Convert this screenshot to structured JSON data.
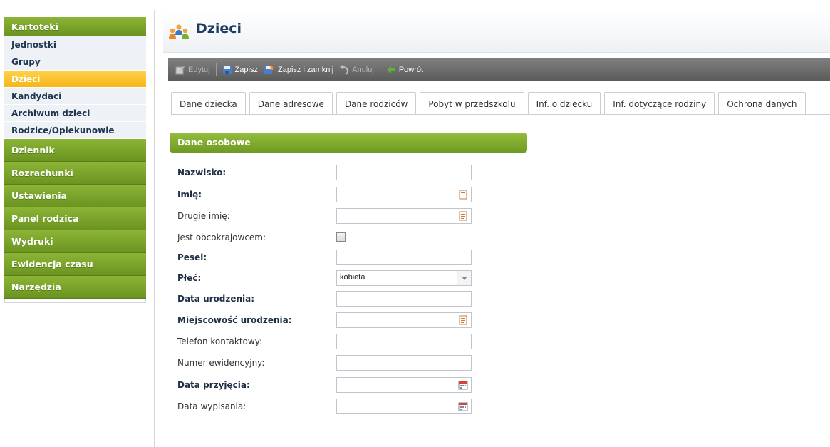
{
  "sidebar": {
    "kartoteki": "Kartoteki",
    "sub_items": [
      "Jednostki",
      "Grupy",
      "Dzieci",
      "Kandydaci",
      "Archiwum dzieci",
      "Rodzice/Opiekunowie"
    ],
    "groups": [
      "Dziennik",
      "Rozrachunki",
      "Ustawienia",
      "Panel rodzica",
      "Wydruki",
      "Ewidencja czasu",
      "Narzędzia"
    ]
  },
  "page": {
    "title": "Dzieci",
    "icon": "children-icon"
  },
  "toolbar": {
    "edit": "Edytuj",
    "save": "Zapisz",
    "save_close": "Zapisz i zamknij",
    "cancel": "Anuluj",
    "back": "Powrót"
  },
  "tabs": [
    "Dane dziecka",
    "Dane adresowe",
    "Dane rodziców",
    "Pobyt w przedszkolu",
    "Inf. o dziecku",
    "Inf. dotyczące rodziny",
    "Ochrona danych"
  ],
  "section": {
    "title": "Dane osobowe"
  },
  "form": {
    "nazwisko": {
      "label": "Nazwisko:",
      "value": ""
    },
    "imie": {
      "label": "Imię:",
      "value": ""
    },
    "drugie_imie": {
      "label": "Drugie imię:",
      "value": ""
    },
    "obcokrajowiec": {
      "label": "Jest obcokrajowcem:",
      "checked": false
    },
    "pesel": {
      "label": "Pesel:",
      "value": ""
    },
    "plec": {
      "label": "Płeć:",
      "value": "kobieta"
    },
    "data_urodzenia": {
      "label": "Data urodzenia:",
      "value": ""
    },
    "miejscowosc": {
      "label": "Miejscowość urodzenia:",
      "value": ""
    },
    "telefon": {
      "label": "Telefon kontaktowy:",
      "value": ""
    },
    "numer_ewid": {
      "label": "Numer ewidencyjny:",
      "value": ""
    },
    "data_przyjecia": {
      "label": "Data przyjęcia:",
      "value": ""
    },
    "data_wypisania": {
      "label": "Data wypisania:",
      "value": ""
    }
  },
  "colors": {
    "sidebar_green": "#7aa52c",
    "active_yellow": "#f8bf23",
    "title_blue": "#1d3a62",
    "toolbar_gray": "#6b6b6b"
  }
}
